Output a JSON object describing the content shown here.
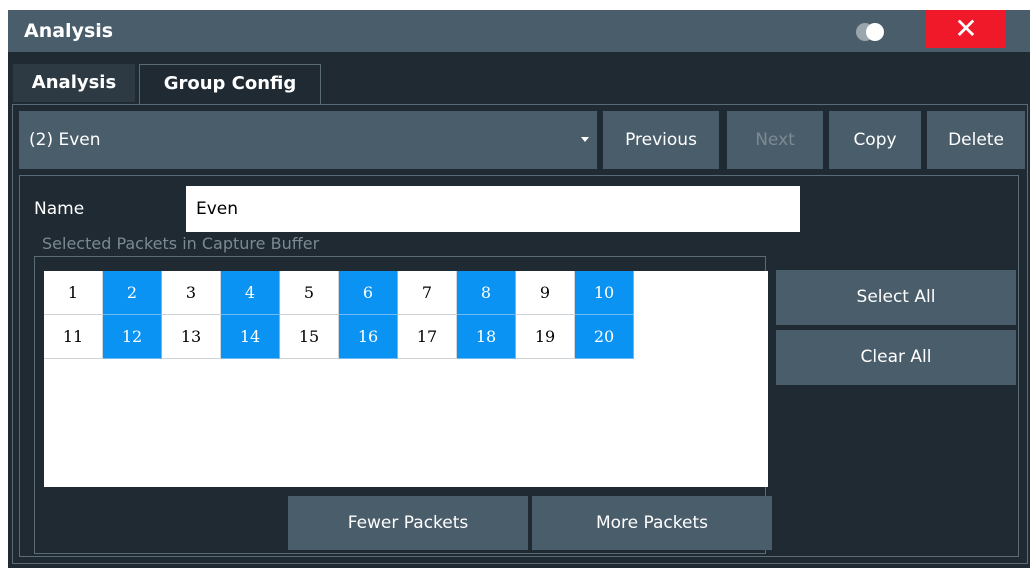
{
  "window": {
    "title": "Analysis",
    "close_label": "✕"
  },
  "tabs": [
    {
      "label": "Analysis"
    },
    {
      "label": "Group Config"
    }
  ],
  "group_select": {
    "value": "(2) Even"
  },
  "nav": {
    "previous": "Previous",
    "next": "Next",
    "copy": "Copy",
    "delete": "Delete"
  },
  "name_field": {
    "label": "Name",
    "value": "Even"
  },
  "buffer": {
    "section_label": "Selected Packets in Capture Buffer",
    "packets": [
      {
        "num": "1",
        "selected": false
      },
      {
        "num": "2",
        "selected": true
      },
      {
        "num": "3",
        "selected": false
      },
      {
        "num": "4",
        "selected": true
      },
      {
        "num": "5",
        "selected": false
      },
      {
        "num": "6",
        "selected": true
      },
      {
        "num": "7",
        "selected": false
      },
      {
        "num": "8",
        "selected": true
      },
      {
        "num": "9",
        "selected": false
      },
      {
        "num": "10",
        "selected": true
      },
      {
        "num": "11",
        "selected": false
      },
      {
        "num": "12",
        "selected": true
      },
      {
        "num": "13",
        "selected": false
      },
      {
        "num": "14",
        "selected": true
      },
      {
        "num": "15",
        "selected": false
      },
      {
        "num": "16",
        "selected": true
      },
      {
        "num": "17",
        "selected": false
      },
      {
        "num": "18",
        "selected": true
      },
      {
        "num": "19",
        "selected": false
      },
      {
        "num": "20",
        "selected": true
      }
    ]
  },
  "actions": {
    "select_all": "Select All",
    "clear_all": "Clear All",
    "fewer_packets": "Fewer Packets",
    "more_packets": "More Packets"
  },
  "colors": {
    "selected_cell": "#0a93f2",
    "title_bar": "#4a5d6a",
    "background": "#1f2a33",
    "close_button": "#f0192a"
  },
  "icons": {
    "toggle": "display-toggle-icon",
    "close": "close-icon",
    "dropdown": "chevron-down-icon"
  }
}
